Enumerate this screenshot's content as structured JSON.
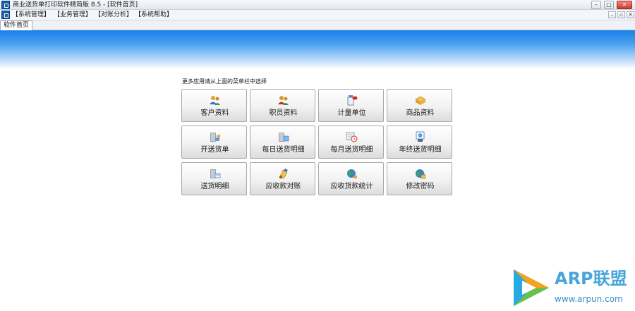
{
  "window": {
    "title": "商业送货单打印软件精简版 8.5 - [软件首页]",
    "controls": {
      "minimize": "–",
      "maximize": "□",
      "close": "✕"
    }
  },
  "menubar": {
    "items": [
      {
        "label": "【系统管理】"
      },
      {
        "label": "【业务管理】"
      },
      {
        "label": "【对账分析】"
      },
      {
        "label": "【系统帮助】"
      }
    ],
    "mdi_controls": {
      "minimize": "–",
      "restore": "▫",
      "close": "✕"
    }
  },
  "tabs": [
    {
      "label": "软件首页"
    }
  ],
  "main": {
    "hint": "更多应用请从上面的菜单栏中选择",
    "tiles": [
      {
        "label": "客户资料",
        "icon": "customers-icon"
      },
      {
        "label": "职员资料",
        "icon": "staff-icon"
      },
      {
        "label": "计量单位",
        "icon": "units-icon"
      },
      {
        "label": "商品资料",
        "icon": "products-icon"
      },
      {
        "label": "开送货单",
        "icon": "create-delivery-icon"
      },
      {
        "label": "每日送货明细",
        "icon": "daily-detail-icon"
      },
      {
        "label": "每月送货明细",
        "icon": "monthly-detail-icon"
      },
      {
        "label": "年终送货明细",
        "icon": "yearly-detail-icon"
      },
      {
        "label": "送货明细",
        "icon": "delivery-detail-icon"
      },
      {
        "label": "应收款对账",
        "icon": "receivables-icon"
      },
      {
        "label": "应收货款统计",
        "icon": "statistics-icon"
      },
      {
        "label": "修改密码",
        "icon": "password-icon"
      }
    ]
  },
  "watermark": {
    "brand": "ARP联盟",
    "url": "www.arpun.com"
  },
  "colors": {
    "banner_top": "#1a7fe6",
    "brand": "#46a6dc"
  }
}
